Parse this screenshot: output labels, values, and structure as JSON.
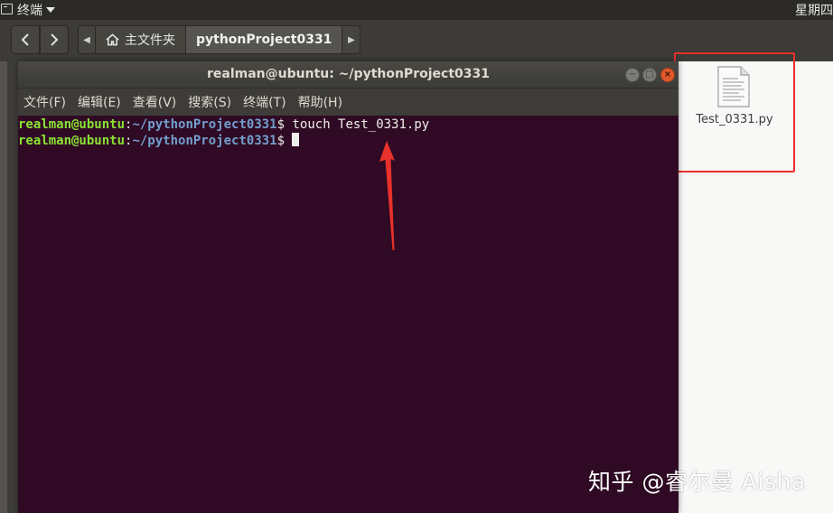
{
  "top_panel": {
    "app_name": "终端",
    "clock": "星期四"
  },
  "file_manager": {
    "breadcrumbs": [
      {
        "label": "主文件夹",
        "icon": "home-icon"
      },
      {
        "label": "pythonProject0331",
        "active": true
      }
    ],
    "files": [
      {
        "name": "Test_0331.py",
        "icon": "python-file-icon"
      }
    ]
  },
  "terminal": {
    "title": "realman@ubuntu: ~/pythonProject0331",
    "menu": [
      "文件(F)",
      "编辑(E)",
      "查看(V)",
      "搜索(S)",
      "终端(T)",
      "帮助(H)"
    ],
    "lines": [
      {
        "user": "realman@ubuntu",
        "path": "~/pythonProject0331",
        "command": " touch Test_0331.py"
      },
      {
        "user": "realman@ubuntu",
        "path": "~/pythonProject0331",
        "command": " "
      }
    ]
  },
  "annotations": {
    "highlight_color": "#e8312a",
    "arrow_color": "#e8312a"
  },
  "watermark": "知乎 @睿尔曼 Aisha",
  "colors": {
    "terminal_bg": "#300a24",
    "prompt_user": "#8ae234",
    "prompt_path": "#729fcf",
    "panel_bg": "#2b2a26"
  }
}
